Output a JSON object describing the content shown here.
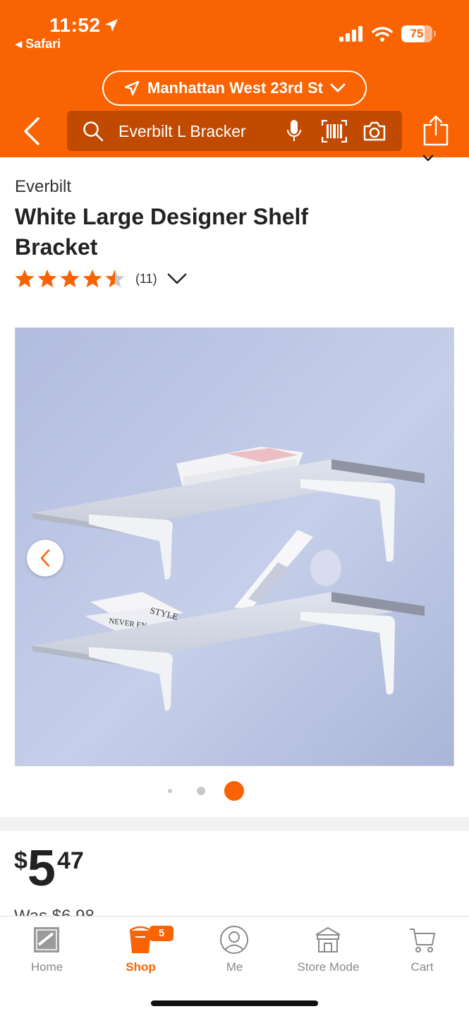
{
  "status_bar": {
    "time": "11:52",
    "back_app": "Safari",
    "battery": "75",
    "battery_level": 0.75
  },
  "header": {
    "store_name": "Manhattan West 23rd St",
    "search_value": "Everbilt L Bracker",
    "icons": [
      "location-arrow-icon",
      "chevron-down-icon",
      "back-icon",
      "search-icon",
      "mic-icon",
      "barcode-icon",
      "camera-icon",
      "share-icon"
    ],
    "brand_color": "#f96302"
  },
  "product": {
    "brand": "Everbilt",
    "title": "White Large Designer Shelf Bracket",
    "rating": 4.5,
    "review_count": "(11)",
    "image_book_text_1": "STYLE",
    "image_book_text_2": "NEVER EN"
  },
  "gallery": {
    "slide_count": 3,
    "active_slide": 3
  },
  "price": {
    "currency": "$",
    "dollars": "5",
    "cents": "47",
    "was": "Was $6.98"
  },
  "tabbar": {
    "tabs": [
      {
        "label": "Home",
        "icon": "home-depot-logo-icon",
        "active": false
      },
      {
        "label": "Shop",
        "icon": "shop-bucket-icon",
        "active": true
      },
      {
        "label": "Me",
        "icon": "user-icon",
        "active": false,
        "badge": "5"
      },
      {
        "label": "Store Mode",
        "icon": "store-icon",
        "active": false
      },
      {
        "label": "Cart",
        "icon": "cart-icon",
        "active": false
      }
    ]
  }
}
